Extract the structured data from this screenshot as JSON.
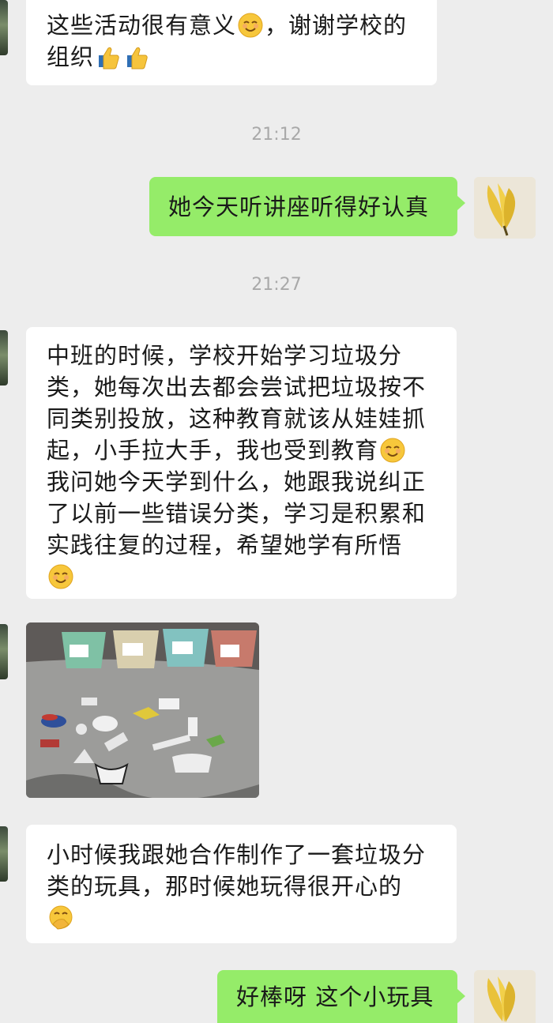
{
  "messages": {
    "m1": {
      "text": "这些活动很有意义",
      "text_after": "，谢谢学校的",
      "line2": "组织"
    },
    "t1": "21:12",
    "m2": "她今天听讲座听得好认真",
    "t2": "21:27",
    "m3": {
      "lines": [
        "中班的时候，学校开始学习垃圾分",
        "类，她每次出去都会尝试把垃圾按不",
        "同类别投放，这种教育就该从娃娃抓",
        "起，小手拉大手，我也受到教育",
        "我问她今天学到什么，她跟我说纠正",
        "了以前一些错误分类，学习是积累和",
        "实践往复的过程，希望她学有所悟"
      ]
    },
    "m5": {
      "lines": [
        "小时候我跟她合作制作了一套垃圾分",
        "类的玩具，那时候她玩得很开心的"
      ]
    },
    "m6": "好棒呀 这个小玩具"
  },
  "icons": {
    "smile": "smiling-face-emoji",
    "thumbs": "thumbs-up-emoji",
    "hand_over_mouth": "face-with-hand-over-mouth-emoji",
    "avatar": "banana-avatar"
  },
  "colors": {
    "background": "#ededed",
    "incoming": "#ffffff",
    "outgoing": "#95ec69",
    "timestamp": "#a9a9a9"
  }
}
